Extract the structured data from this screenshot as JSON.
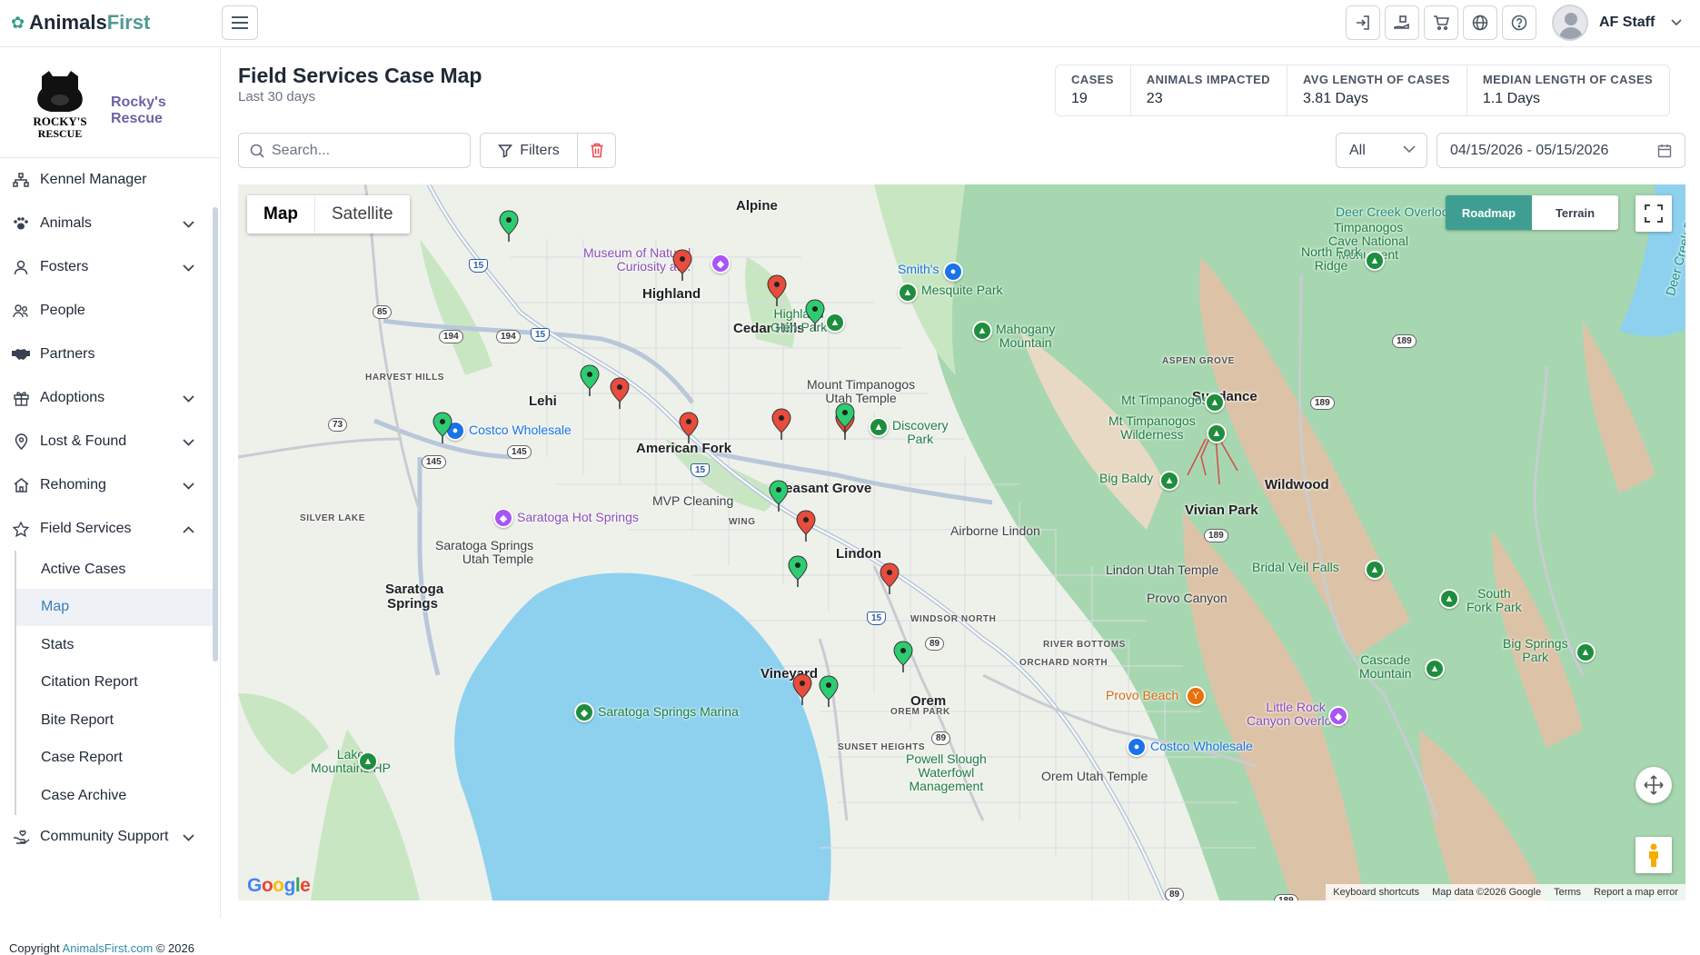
{
  "brand": {
    "part1": "Animals",
    "part2": "First"
  },
  "user": {
    "name": "AF Staff"
  },
  "org": {
    "name": "Rocky's Rescue",
    "logo_text_1": "ROCKY'S",
    "logo_text_2": "RESCUE"
  },
  "nav": [
    {
      "label": "Kennel Manager",
      "icon": "sitemap-icon",
      "chevron": false
    },
    {
      "label": "Animals",
      "icon": "paw-icon",
      "chevron": true
    },
    {
      "label": "Fosters",
      "icon": "person-icon",
      "chevron": true
    },
    {
      "label": "People",
      "icon": "people-icon",
      "chevron": false
    },
    {
      "label": "Partners",
      "icon": "handshake-icon",
      "chevron": false
    },
    {
      "label": "Adoptions",
      "icon": "gift-icon",
      "chevron": true
    },
    {
      "label": "Lost & Found",
      "icon": "location-pin-icon",
      "chevron": true
    },
    {
      "label": "Rehoming",
      "icon": "house-icon",
      "chevron": true
    },
    {
      "label": "Field Services",
      "icon": "star-icon",
      "chevron": true
    }
  ],
  "field_services_sub": [
    "Active Cases",
    "Map",
    "Stats",
    "Citation Report",
    "Bite Report",
    "Case Report",
    "Case Archive"
  ],
  "nav_after": {
    "label": "Community Support",
    "icon": "hand-heart-icon"
  },
  "copyright": {
    "prefix": "Copyright ",
    "link": "AnimalsFirst.com",
    "suffix": " © 2026"
  },
  "page": {
    "title": "Field Services Case Map",
    "subtitle": "Last 30 days"
  },
  "stats": [
    {
      "label": "CASES",
      "value": "19"
    },
    {
      "label": "ANIMALS IMPACTED",
      "value": "23"
    },
    {
      "label": "AVG LENGTH OF CASES",
      "value": "3.81 Days"
    },
    {
      "label": "MEDIAN LENGTH OF CASES",
      "value": "1.1 Days"
    }
  ],
  "toolbar": {
    "search_placeholder": "Search...",
    "filters_label": "Filters",
    "select_value": "All",
    "date_range": "04/15/2026 - 05/15/2026"
  },
  "map": {
    "type_map": "Map",
    "type_satellite": "Satellite",
    "style_roadmap": "Roadmap",
    "style_terrain": "Terrain",
    "attribution": [
      "Keyboard shortcuts",
      "Map data ©2026 Google",
      "Terms",
      "Report a map error"
    ],
    "google": "Google",
    "cities": [
      "Alpine",
      "Highland",
      "Cedar Hills",
      "Lehi",
      "American Fork",
      "Pleasant Grove",
      "Lindon",
      "Vineyard",
      "Orem",
      "Saratoga Springs",
      "Sundance",
      "Wildwood",
      "Vivian Park"
    ],
    "places": [
      "Museum of Natural Curiosity at...",
      "Smith's",
      "Highland Glen Park",
      "Mesquite Park",
      "Mahogany Mountain",
      "Timpanogos Cave National Monument",
      "Deer Creek Overlook",
      "North Fork Ridge",
      "Mount Timpanogos Utah Temple",
      "Costco Wholesale",
      "Discovery Park",
      "Mt Timpanogos",
      "Mt Timpanogos Wilderness",
      "Big Baldy",
      "MVP Cleaning",
      "Saratoga Hot Springs",
      "Saratoga Springs Utah Temple",
      "Airborne Lindon",
      "Lindon Utah Temple",
      "Bridal Veil Falls",
      "South Fork Park",
      "Provo Canyon",
      "Big Springs Park",
      "Cascade Mountain",
      "Provo Beach",
      "Little Rock Canyon Overlook",
      "Saratoga Springs Marina",
      "Costco Wholesale",
      "Powell Slough Waterfowl Management",
      "Orem Utah Temple",
      "Lake Mountains HP",
      "Deer Creek Res"
    ],
    "areas": [
      "HARVEST HILLS",
      "SILVER LAKE",
      "ASPEN GROVE",
      "WING",
      "WINDSOR NORTH",
      "RIVER BOTTOMS",
      "ORCHARD NORTH",
      "OREM PARK",
      "SUNSET HEIGHTS"
    ],
    "shields": [
      "15",
      "85",
      "194",
      "194",
      "15",
      "73",
      "145",
      "145",
      "15",
      "189",
      "189",
      "189",
      "89",
      "15",
      "89",
      "89",
      "189"
    ],
    "pin_colors": {
      "open": "#e74c3c",
      "closed": "#2ecc71"
    }
  }
}
